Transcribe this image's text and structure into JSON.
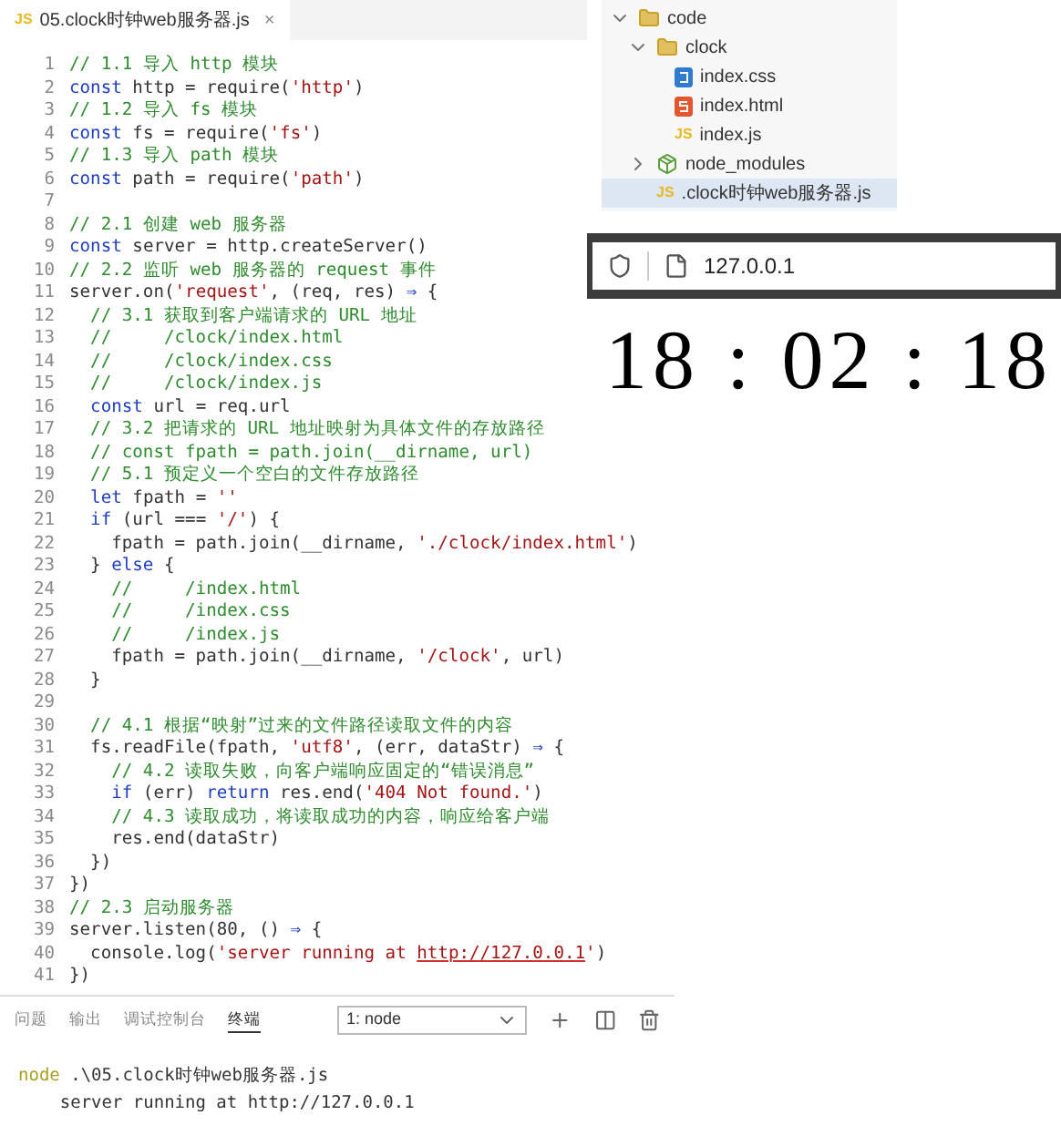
{
  "editor": {
    "tab": {
      "icon_text": "JS",
      "label": "05.clock时钟web服务器.js",
      "close": "×"
    },
    "lines": [
      {
        "number": "1",
        "tokens": [
          {
            "kind": "comment",
            "text": "// 1.1 导入 http 模块"
          }
        ]
      },
      {
        "number": "2",
        "tokens": [
          {
            "kind": "keyword",
            "text": "const"
          },
          {
            "kind": "plain",
            "text": " http = require("
          },
          {
            "kind": "string",
            "text": "'http'"
          },
          {
            "kind": "plain",
            "text": ")"
          }
        ]
      },
      {
        "number": "3",
        "tokens": [
          {
            "kind": "comment",
            "text": "// 1.2 导入 fs 模块"
          }
        ]
      },
      {
        "number": "4",
        "tokens": [
          {
            "kind": "keyword",
            "text": "const"
          },
          {
            "kind": "plain",
            "text": " fs = require("
          },
          {
            "kind": "string",
            "text": "'fs'"
          },
          {
            "kind": "plain",
            "text": ")"
          }
        ]
      },
      {
        "number": "5",
        "tokens": [
          {
            "kind": "comment",
            "text": "// 1.3 导入 path 模块"
          }
        ]
      },
      {
        "number": "6",
        "tokens": [
          {
            "kind": "keyword",
            "text": "const"
          },
          {
            "kind": "plain",
            "text": " path = require("
          },
          {
            "kind": "string",
            "text": "'path'"
          },
          {
            "kind": "plain",
            "text": ")"
          }
        ]
      },
      {
        "number": "7"
      },
      {
        "number": "8",
        "tokens": [
          {
            "kind": "comment",
            "text": "// 2.1 创建 web 服务器"
          }
        ]
      },
      {
        "number": "9",
        "tokens": [
          {
            "kind": "keyword",
            "text": "const"
          },
          {
            "kind": "plain",
            "text": " server = http.createServer()"
          }
        ]
      },
      {
        "number": "10",
        "tokens": [
          {
            "kind": "comment",
            "text": "// 2.2 监听 web 服务器的 request 事件"
          }
        ]
      },
      {
        "number": "11",
        "tokens": [
          {
            "kind": "plain",
            "text": "server.on("
          },
          {
            "kind": "string",
            "text": "'request'"
          },
          {
            "kind": "plain",
            "text": ", (req, res) "
          },
          {
            "kind": "keyword",
            "text": "⇒"
          },
          {
            "kind": "plain",
            "text": " {"
          }
        ]
      },
      {
        "number": "12",
        "tokens": [
          {
            "kind": "comment",
            "text": "  // 3.1 获取到客户端请求的 URL 地址"
          }
        ]
      },
      {
        "number": "13",
        "tokens": [
          {
            "kind": "comment",
            "text": "  //     /clock/index.html"
          }
        ]
      },
      {
        "number": "14",
        "tokens": [
          {
            "kind": "comment",
            "text": "  //     /clock/index.css"
          }
        ]
      },
      {
        "number": "15",
        "tokens": [
          {
            "kind": "comment",
            "text": "  //     /clock/index.js"
          }
        ]
      },
      {
        "number": "16",
        "tokens": [
          {
            "kind": "keyword",
            "text": "  const"
          },
          {
            "kind": "plain",
            "text": " url = req.url"
          }
        ]
      },
      {
        "number": "17",
        "tokens": [
          {
            "kind": "comment",
            "text": "  // 3.2 把请求的 URL 地址映射为具体文件的存放路径"
          }
        ]
      },
      {
        "number": "18",
        "tokens": [
          {
            "kind": "comment",
            "text": "  // const fpath = path.join(__dirname, url)"
          }
        ]
      },
      {
        "number": "19",
        "tokens": [
          {
            "kind": "comment",
            "text": "  // 5.1 预定义一个空白的文件存放路径"
          }
        ]
      },
      {
        "number": "20",
        "tokens": [
          {
            "kind": "keyword",
            "text": "  let"
          },
          {
            "kind": "plain",
            "text": " fpath = "
          },
          {
            "kind": "string",
            "text": "''"
          }
        ]
      },
      {
        "number": "21",
        "tokens": [
          {
            "kind": "keyword",
            "text": "  if"
          },
          {
            "kind": "plain",
            "text": " (url === "
          },
          {
            "kind": "string",
            "text": "'/'"
          },
          {
            "kind": "plain",
            "text": ") {"
          }
        ]
      },
      {
        "number": "22",
        "tokens": [
          {
            "kind": "plain",
            "text": "    fpath = path.join(__dirname, "
          },
          {
            "kind": "string",
            "text": "'./clock/index.html'"
          },
          {
            "kind": "plain",
            "text": ")"
          }
        ]
      },
      {
        "number": "23",
        "tokens": [
          {
            "kind": "plain",
            "text": "  } "
          },
          {
            "kind": "keyword",
            "text": "else"
          },
          {
            "kind": "plain",
            "text": " {"
          }
        ]
      },
      {
        "number": "24",
        "tokens": [
          {
            "kind": "comment",
            "text": "    //     /index.html"
          }
        ]
      },
      {
        "number": "25",
        "tokens": [
          {
            "kind": "comment",
            "text": "    //     /index.css"
          }
        ]
      },
      {
        "number": "26",
        "tokens": [
          {
            "kind": "comment",
            "text": "    //     /index.js"
          }
        ]
      },
      {
        "number": "27",
        "tokens": [
          {
            "kind": "plain",
            "text": "    fpath = path.join(__dirname, "
          },
          {
            "kind": "string",
            "text": "'/clock'"
          },
          {
            "kind": "plain",
            "text": ", url)"
          }
        ]
      },
      {
        "number": "28",
        "tokens": [
          {
            "kind": "plain",
            "text": "  }"
          }
        ]
      },
      {
        "number": "29"
      },
      {
        "number": "30",
        "tokens": [
          {
            "kind": "comment",
            "text": "  // 4.1 根据“映射”过来的文件路径读取文件的内容"
          }
        ]
      },
      {
        "number": "31",
        "tokens": [
          {
            "kind": "plain",
            "text": "  fs.readFile(fpath, "
          },
          {
            "kind": "string",
            "text": "'utf8'"
          },
          {
            "kind": "plain",
            "text": ", (err, dataStr) "
          },
          {
            "kind": "keyword",
            "text": "⇒"
          },
          {
            "kind": "plain",
            "text": " {"
          }
        ]
      },
      {
        "number": "32",
        "tokens": [
          {
            "kind": "comment",
            "text": "    // 4.2 读取失败，向客户端响应固定的“错误消息”"
          }
        ]
      },
      {
        "number": "33",
        "tokens": [
          {
            "kind": "keyword",
            "text": "    if"
          },
          {
            "kind": "plain",
            "text": " (err) "
          },
          {
            "kind": "keyword",
            "text": "return"
          },
          {
            "kind": "plain",
            "text": " res.end("
          },
          {
            "kind": "string",
            "text": "'404 Not found.'"
          },
          {
            "kind": "plain",
            "text": ")"
          }
        ]
      },
      {
        "number": "34",
        "tokens": [
          {
            "kind": "comment",
            "text": "    // 4.3 读取成功，将读取成功的内容，响应给客户端"
          }
        ]
      },
      {
        "number": "35",
        "tokens": [
          {
            "kind": "plain",
            "text": "    res.end(dataStr)"
          }
        ]
      },
      {
        "number": "36",
        "tokens": [
          {
            "kind": "plain",
            "text": "  })"
          }
        ]
      },
      {
        "number": "37",
        "tokens": [
          {
            "kind": "plain",
            "text": "})"
          }
        ]
      },
      {
        "number": "38",
        "tokens": [
          {
            "kind": "comment",
            "text": "// 2.3 启动服务器"
          }
        ]
      },
      {
        "number": "39",
        "tokens": [
          {
            "kind": "plain",
            "text": "server.listen(80, () "
          },
          {
            "kind": "keyword",
            "text": "⇒"
          },
          {
            "kind": "plain",
            "text": " {"
          }
        ]
      },
      {
        "number": "40",
        "tokens": [
          {
            "kind": "plain",
            "text": "  console.log("
          },
          {
            "kind": "string",
            "text": "'server running at "
          },
          {
            "kind": "link",
            "text": "http://127.0.0.1"
          },
          {
            "kind": "string",
            "text": "'"
          },
          {
            "kind": "plain",
            "text": ")"
          }
        ]
      },
      {
        "number": "41",
        "tokens": [
          {
            "kind": "plain",
            "text": "})"
          }
        ]
      }
    ]
  },
  "explorer": {
    "items": [
      {
        "label": "code",
        "kind": "folder",
        "expanded": true,
        "selected": false,
        "children": [
          {
            "label": "clock",
            "kind": "folder",
            "expanded": true,
            "selected": false,
            "children": [
              {
                "label": "index.css",
                "kind": "css",
                "selected": false
              },
              {
                "label": "index.html",
                "kind": "html",
                "selected": false
              },
              {
                "label": "index.js",
                "kind": "js",
                "icon_text": "JS",
                "selected": false
              }
            ]
          },
          {
            "label": "node_modules",
            "kind": "modules",
            "expanded": false,
            "selected": false
          },
          {
            "label": ".clock时钟web服务器.js",
            "kind": "js",
            "icon_text": "JS",
            "selected": true
          }
        ]
      }
    ]
  },
  "browser": {
    "address": "127.0.0.1",
    "clock": "18 : 02 : 18"
  },
  "panel": {
    "tabs": [
      {
        "label": "问题",
        "selected": false
      },
      {
        "label": "输出",
        "selected": false
      },
      {
        "label": "调试控制台",
        "selected": false
      },
      {
        "label": "终端",
        "selected": true
      }
    ],
    "terminal_select": "1: node",
    "terminal": [
      {
        "prompt": "node",
        "text": " .\\05.clock时钟web服务器.js"
      },
      {
        "text": "    server running at http://127.0.0.1"
      }
    ]
  }
}
